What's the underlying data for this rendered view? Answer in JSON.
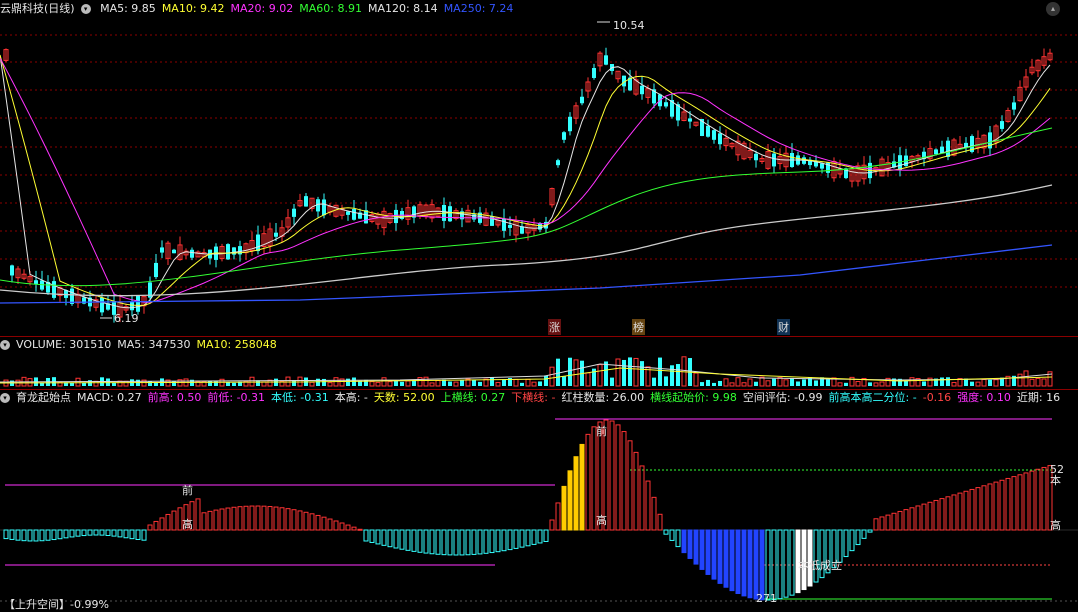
{
  "price_panel": {
    "title": "云鼎科技(日线)",
    "ma_labels": [
      {
        "text": "MA5: 9.85",
        "color": "#e6e6e6"
      },
      {
        "text": "MA10: 9.42",
        "color": "#ffff33"
      },
      {
        "text": "MA20: 9.02",
        "color": "#ff33ff"
      },
      {
        "text": "MA60: 8.91",
        "color": "#33ff33"
      },
      {
        "text": "MA120: 8.14",
        "color": "#e6e6e6"
      },
      {
        "text": "MA250: 7.24",
        "color": "#3355ff"
      }
    ],
    "high_label": "10.54",
    "low_label": "6.19",
    "event_tags": [
      {
        "text": "涨",
        "color": "#ff4444"
      },
      {
        "text": "榜",
        "color": "#ffcc33"
      },
      {
        "text": "财",
        "color": "#66ccff"
      }
    ]
  },
  "volume_panel": {
    "labels": [
      {
        "text": "VOLUME: 301510",
        "color": "#e6e6e6"
      },
      {
        "text": "MA5: 347530",
        "color": "#e6e6e6"
      },
      {
        "text": "MA10: 258048",
        "color": "#ffff33"
      }
    ]
  },
  "indicator_panel": {
    "labels": [
      {
        "text": "育龙起始点",
        "color": "#e6e6e6"
      },
      {
        "text": "MACD: 0.27",
        "color": "#e6e6e6"
      },
      {
        "text": "前高: 0.50",
        "color": "#ff33ff"
      },
      {
        "text": "前低: -0.31",
        "color": "#ff33ff"
      },
      {
        "text": "本低: -0.31",
        "color": "#33ffff"
      },
      {
        "text": "本高: -",
        "color": "#e6e6e6"
      },
      {
        "text": "天数: 52.00",
        "color": "#ffff33"
      },
      {
        "text": "上横线: 0.27",
        "color": "#33ff33"
      },
      {
        "text": "下横线: -",
        "color": "#ff4444"
      },
      {
        "text": "红柱数量: 26.00",
        "color": "#e6e6e6"
      },
      {
        "text": "横线起始价: 9.98",
        "color": "#33ff33"
      },
      {
        "text": "空间评估: -0.99",
        "color": "#e6e6e6"
      },
      {
        "text": "前高本高二分位: -",
        "color": "#33ffff"
      },
      {
        "text": "-0.16",
        "color": "#ff4444"
      },
      {
        "text": "强度: 0.10",
        "color": "#ff33ff"
      },
      {
        "text": "近期: 16",
        "color": "#e6e6e6"
      }
    ],
    "annotations": {
      "qian": "前",
      "gao": "高",
      "ben": "本",
      "ben_di": "本低成立",
      "num52": "52",
      "num271": "271",
      "space": "【上升空间】-0.99%"
    }
  },
  "colors": {
    "up": "#ff3333",
    "down": "#33ffff",
    "ma5": "#e6e6e6",
    "ma10": "#ffff33",
    "ma20": "#ff33ff",
    "ma60": "#33ff33",
    "ma120": "#cccccc",
    "ma250": "#3355ff"
  }
}
